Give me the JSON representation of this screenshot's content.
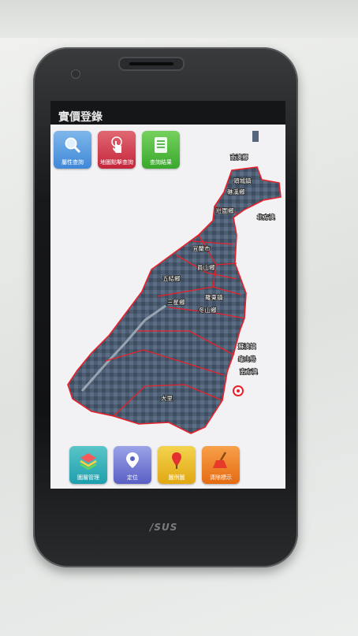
{
  "app": {
    "title": "實價登錄"
  },
  "phone": {
    "brand": "/SUS"
  },
  "toolbar_top": [
    {
      "key": "attribute_query",
      "label": "屬性查詢",
      "icon": "magnifier-icon"
    },
    {
      "key": "map_click_query",
      "label": "地圖點擊查詢",
      "icon": "tap-hand-icon"
    },
    {
      "key": "query_results",
      "label": "查詢結果",
      "icon": "list-icon"
    }
  ],
  "toolbar_bottom": [
    {
      "key": "layer_management",
      "label": "圖層管理",
      "icon": "layers-icon"
    },
    {
      "key": "locate",
      "label": "定位",
      "icon": "location-pin-icon"
    },
    {
      "key": "legend",
      "label": "圖例圖",
      "icon": "marker-icon"
    },
    {
      "key": "clear_markers",
      "label": "清除標示",
      "icon": "broom-icon"
    }
  ],
  "map": {
    "boundary_color": "#e8202a",
    "places": [
      "頭城鎮",
      "礁溪鄉",
      "宜蘭市",
      "壯圍鄉",
      "員山鄉",
      "五結鄉",
      "羅東鎮",
      "三星鄉",
      "冬山鄉",
      "蘇澳鎮",
      "南澳鄉",
      "龜山島",
      "大里",
      "北方澳",
      "南方澳"
    ]
  }
}
